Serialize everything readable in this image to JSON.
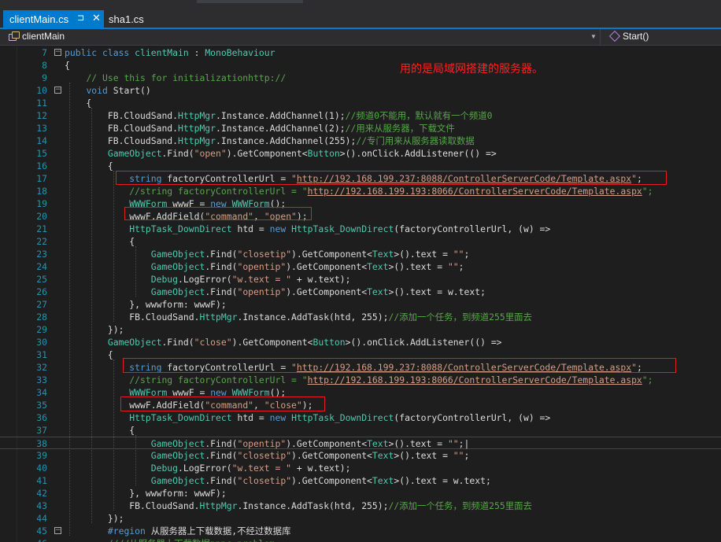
{
  "tabs": [
    {
      "label": "clientMain.cs",
      "pin": "⊐",
      "close": "✕",
      "active": true
    },
    {
      "label": "sha1.cs",
      "active": false
    }
  ],
  "nav": {
    "class_name": "clientMain",
    "method_name": "Start()"
  },
  "annotation": "用的是局域网搭建的服务器。",
  "colors": {
    "accent": "#007acc",
    "highlight_box": "#e31b23",
    "annotation": "#ff2020"
  },
  "code_lines": [
    {
      "n": "7",
      "fold": "−",
      "segs": [
        [
          "kw",
          "public class "
        ],
        [
          "ty",
          "clientMain"
        ],
        [
          "p",
          " : "
        ],
        [
          "ty",
          "MonoBehaviour"
        ]
      ]
    },
    {
      "n": "8",
      "segs": [
        [
          "p",
          "{"
        ]
      ]
    },
    {
      "n": "9",
      "segs": [
        [
          "p",
          "    "
        ],
        [
          "cm",
          "// Use this for initializationhttp://"
        ]
      ]
    },
    {
      "n": "10",
      "fold": "−",
      "segs": [
        [
          "p",
          "    "
        ],
        [
          "kw",
          "void"
        ],
        [
          "p",
          " Start()"
        ]
      ]
    },
    {
      "n": "11",
      "segs": [
        [
          "p",
          "    {"
        ]
      ]
    },
    {
      "n": "12",
      "segs": [
        [
          "p",
          "        FB.CloudSand."
        ],
        [
          "ty",
          "HttpMgr"
        ],
        [
          "p",
          ".Instance.AddChannel(1);"
        ],
        [
          "cm",
          "//频道0不能用，默认就有一个频道0"
        ]
      ]
    },
    {
      "n": "13",
      "segs": [
        [
          "p",
          "        FB.CloudSand."
        ],
        [
          "ty",
          "HttpMgr"
        ],
        [
          "p",
          ".Instance.AddChannel(2);"
        ],
        [
          "cm",
          "//用来从服务器，下载文件"
        ]
      ]
    },
    {
      "n": "14",
      "segs": [
        [
          "p",
          "        FB.CloudSand."
        ],
        [
          "ty",
          "HttpMgr"
        ],
        [
          "p",
          ".Instance.AddChannel(255);"
        ],
        [
          "cm",
          "//专门用来从服务器读取数据"
        ]
      ]
    },
    {
      "n": "15",
      "segs": [
        [
          "p",
          "        "
        ],
        [
          "ty",
          "GameObject"
        ],
        [
          "p",
          ".Find("
        ],
        [
          "st",
          "\"open\""
        ],
        [
          "p",
          ").GetComponent<"
        ],
        [
          "ty",
          "Button"
        ],
        [
          "p",
          ">().onClick.AddListener(() =>"
        ]
      ]
    },
    {
      "n": "16",
      "segs": [
        [
          "p",
          "        {"
        ]
      ]
    },
    {
      "n": "17",
      "segs": [
        [
          "p",
          "            "
        ],
        [
          "kw",
          "string"
        ],
        [
          "p",
          " factoryControllerUrl = "
        ],
        [
          "st",
          "\""
        ],
        [
          "url",
          "http://192.168.199.237:8088/ControllerServerCode/Template.aspx"
        ],
        [
          "st",
          "\""
        ],
        [
          "p",
          ";"
        ]
      ]
    },
    {
      "n": "18",
      "segs": [
        [
          "p",
          "            "
        ],
        [
          "cm",
          "//string factoryControllerUrl = \""
        ],
        [
          "url",
          "http://192.168.199.193:8066/ControllerServerCode/Template.aspx"
        ],
        [
          "cm",
          "\";"
        ]
      ]
    },
    {
      "n": "19",
      "segs": [
        [
          "p",
          "            "
        ],
        [
          "ty",
          "WWWForm"
        ],
        [
          "p",
          " wwwF = "
        ],
        [
          "kw",
          "new"
        ],
        [
          "p",
          " "
        ],
        [
          "ty",
          "WWWForm"
        ],
        [
          "p",
          "();"
        ]
      ]
    },
    {
      "n": "20",
      "segs": [
        [
          "p",
          "            wwwF.AddField("
        ],
        [
          "st",
          "\"command\""
        ],
        [
          "p",
          ", "
        ],
        [
          "st",
          "\"open\""
        ],
        [
          "p",
          ");"
        ]
      ]
    },
    {
      "n": "21",
      "segs": [
        [
          "p",
          "            "
        ],
        [
          "ty",
          "HttpTask_DownDirect"
        ],
        [
          "p",
          " htd = "
        ],
        [
          "kw",
          "new"
        ],
        [
          "p",
          " "
        ],
        [
          "ty",
          "HttpTask_DownDirect"
        ],
        [
          "p",
          "(factoryControllerUrl, (w) =>"
        ]
      ]
    },
    {
      "n": "22",
      "segs": [
        [
          "p",
          "            {"
        ]
      ]
    },
    {
      "n": "23",
      "segs": [
        [
          "p",
          "                "
        ],
        [
          "ty",
          "GameObject"
        ],
        [
          "p",
          ".Find("
        ],
        [
          "st",
          "\"closetip\""
        ],
        [
          "p",
          ").GetComponent<"
        ],
        [
          "ty",
          "Text"
        ],
        [
          "p",
          ">().text = "
        ],
        [
          "st",
          "\"\""
        ],
        [
          "p",
          ";"
        ]
      ]
    },
    {
      "n": "24",
      "segs": [
        [
          "p",
          "                "
        ],
        [
          "ty",
          "GameObject"
        ],
        [
          "p",
          ".Find("
        ],
        [
          "st",
          "\"opentip\""
        ],
        [
          "p",
          ").GetComponent<"
        ],
        [
          "ty",
          "Text"
        ],
        [
          "p",
          ">().text = "
        ],
        [
          "st",
          "\"\""
        ],
        [
          "p",
          ";"
        ]
      ]
    },
    {
      "n": "25",
      "segs": [
        [
          "p",
          "                "
        ],
        [
          "ty",
          "Debug"
        ],
        [
          "p",
          ".LogError("
        ],
        [
          "st",
          "\"w.text = \""
        ],
        [
          "p",
          " + w.text);"
        ]
      ]
    },
    {
      "n": "26",
      "segs": [
        [
          "p",
          "                "
        ],
        [
          "ty",
          "GameObject"
        ],
        [
          "p",
          ".Find("
        ],
        [
          "st",
          "\"opentip\""
        ],
        [
          "p",
          ").GetComponent<"
        ],
        [
          "ty",
          "Text"
        ],
        [
          "p",
          ">().text = w.text;"
        ]
      ]
    },
    {
      "n": "27",
      "segs": [
        [
          "p",
          "            }, wwwform: wwwF);"
        ]
      ]
    },
    {
      "n": "28",
      "segs": [
        [
          "p",
          "            FB.CloudSand."
        ],
        [
          "ty",
          "HttpMgr"
        ],
        [
          "p",
          ".Instance.AddTask(htd, 255);"
        ],
        [
          "cm",
          "//添加一个任务，到频道255里面去"
        ]
      ]
    },
    {
      "n": "29",
      "segs": [
        [
          "p",
          "        });"
        ]
      ]
    },
    {
      "n": "30",
      "segs": [
        [
          "p",
          "        "
        ],
        [
          "ty",
          "GameObject"
        ],
        [
          "p",
          ".Find("
        ],
        [
          "st",
          "\"close\""
        ],
        [
          "p",
          ").GetComponent<"
        ],
        [
          "ty",
          "Button"
        ],
        [
          "p",
          ">().onClick.AddListener(() =>"
        ]
      ]
    },
    {
      "n": "31",
      "segs": [
        [
          "p",
          "        {"
        ]
      ]
    },
    {
      "n": "32",
      "segs": [
        [
          "p",
          "            "
        ],
        [
          "kw",
          "string"
        ],
        [
          "p",
          " factoryControllerUrl = "
        ],
        [
          "st",
          "\""
        ],
        [
          "url",
          "http://192.168.199.237:8088/ControllerServerCode/Template.aspx"
        ],
        [
          "st",
          "\""
        ],
        [
          "p",
          ";"
        ]
      ]
    },
    {
      "n": "33",
      "segs": [
        [
          "p",
          "            "
        ],
        [
          "cm",
          "//string factoryControllerUrl = \""
        ],
        [
          "url",
          "http://192.168.199.193:8066/ControllerServerCode/Template.aspx"
        ],
        [
          "cm",
          "\";"
        ]
      ]
    },
    {
      "n": "34",
      "segs": [
        [
          "p",
          "            "
        ],
        [
          "ty",
          "WWWForm"
        ],
        [
          "p",
          " wwwF = "
        ],
        [
          "kw",
          "new"
        ],
        [
          "p",
          " "
        ],
        [
          "ty",
          "WWWForm"
        ],
        [
          "p",
          "();"
        ]
      ]
    },
    {
      "n": "35",
      "segs": [
        [
          "p",
          "            wwwF.AddField("
        ],
        [
          "st",
          "\"command\""
        ],
        [
          "p",
          ", "
        ],
        [
          "st",
          "\"close\""
        ],
        [
          "p",
          ");"
        ]
      ]
    },
    {
      "n": "36",
      "segs": [
        [
          "p",
          "            "
        ],
        [
          "ty",
          "HttpTask_DownDirect"
        ],
        [
          "p",
          " htd = "
        ],
        [
          "kw",
          "new"
        ],
        [
          "p",
          " "
        ],
        [
          "ty",
          "HttpTask_DownDirect"
        ],
        [
          "p",
          "(factoryControllerUrl, (w) =>"
        ]
      ]
    },
    {
      "n": "37",
      "segs": [
        [
          "p",
          "            {"
        ]
      ]
    },
    {
      "n": "38",
      "current": true,
      "segs": [
        [
          "p",
          "                "
        ],
        [
          "ty",
          "GameObject"
        ],
        [
          "p",
          ".Find("
        ],
        [
          "st",
          "\"opentip\""
        ],
        [
          "p",
          ").GetComponent<"
        ],
        [
          "ty",
          "Text"
        ],
        [
          "p",
          ">().text = "
        ],
        [
          "st",
          "\"\""
        ],
        [
          "p",
          ";|"
        ]
      ]
    },
    {
      "n": "39",
      "segs": [
        [
          "p",
          "                "
        ],
        [
          "ty",
          "GameObject"
        ],
        [
          "p",
          ".Find("
        ],
        [
          "st",
          "\"closetip\""
        ],
        [
          "p",
          ").GetComponent<"
        ],
        [
          "ty",
          "Text"
        ],
        [
          "p",
          ">().text = "
        ],
        [
          "st",
          "\"\""
        ],
        [
          "p",
          ";"
        ]
      ]
    },
    {
      "n": "40",
      "segs": [
        [
          "p",
          "                "
        ],
        [
          "ty",
          "Debug"
        ],
        [
          "p",
          ".LogError("
        ],
        [
          "st",
          "\"w.text = \""
        ],
        [
          "p",
          " + w.text);"
        ]
      ]
    },
    {
      "n": "41",
      "segs": [
        [
          "p",
          "                "
        ],
        [
          "ty",
          "GameObject"
        ],
        [
          "p",
          ".Find("
        ],
        [
          "st",
          "\"closetip\""
        ],
        [
          "p",
          ").GetComponent<"
        ],
        [
          "ty",
          "Text"
        ],
        [
          "p",
          ">().text = w.text;"
        ]
      ]
    },
    {
      "n": "42",
      "segs": [
        [
          "p",
          "            }, wwwform: wwwF);"
        ]
      ]
    },
    {
      "n": "43",
      "segs": [
        [
          "p",
          "            FB.CloudSand."
        ],
        [
          "ty",
          "HttpMgr"
        ],
        [
          "p",
          ".Instance.AddTask(htd, 255);"
        ],
        [
          "cm",
          "//添加一个任务，到频道255里面去"
        ]
      ]
    },
    {
      "n": "44",
      "segs": [
        [
          "p",
          "        });"
        ]
      ]
    },
    {
      "n": "45",
      "fold": "−",
      "segs": [
        [
          "p",
          "        "
        ],
        [
          "kw",
          "#region"
        ],
        [
          "p",
          " 从服务器上下载数据,不经过数据库"
        ]
      ]
    },
    {
      "n": "46",
      "segs": [
        [
          "p",
          "        "
        ],
        [
          "cm",
          "////从服务器上下载数据pppc problem"
        ]
      ]
    }
  ]
}
